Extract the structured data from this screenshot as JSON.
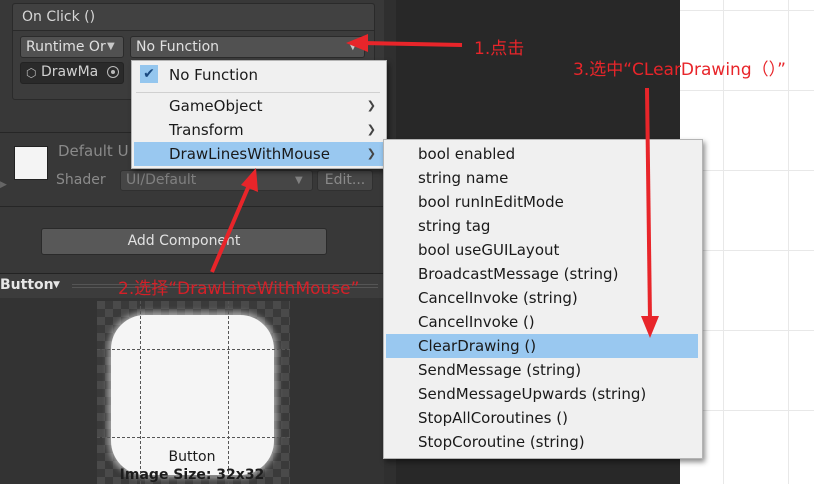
{
  "onclick": {
    "title": "On Click ()",
    "runtime_dropdown": "Runtime Or",
    "function_dropdown": "No Function",
    "object_field": "DrawMa"
  },
  "material": {
    "name": "Default U",
    "shader_label": "Shader",
    "shader_value": "UI/Default",
    "edit_button": "Edit..."
  },
  "add_component_label": "Add Component",
  "preview": {
    "title": "Button",
    "sprite_name": "Button",
    "image_size": "Image Size: 32x32"
  },
  "function_menu": {
    "items": [
      {
        "label": "No Function",
        "checked": true
      },
      {
        "label": "GameObject",
        "submenu": true
      },
      {
        "label": "Transform",
        "submenu": true
      },
      {
        "label": "DrawLinesWithMouse",
        "submenu": true,
        "highlighted": true
      }
    ]
  },
  "member_menu": {
    "items": [
      {
        "label": "bool enabled"
      },
      {
        "label": "string name"
      },
      {
        "label": "bool runInEditMode"
      },
      {
        "label": "string tag"
      },
      {
        "label": "bool useGUILayout"
      },
      {
        "label": "BroadcastMessage (string)"
      },
      {
        "label": "CancelInvoke (string)"
      },
      {
        "label": "CancelInvoke ()"
      },
      {
        "label": "ClearDrawing ()",
        "highlighted": true
      },
      {
        "label": "SendMessage (string)"
      },
      {
        "label": "SendMessageUpwards (string)"
      },
      {
        "label": "StopAllCoroutines ()"
      },
      {
        "label": "StopCoroutine (string)"
      }
    ]
  },
  "annotations": {
    "step1": "1.点击",
    "step2": "2.选择“DrawLineWithMouse”",
    "step3": "3.选中“CLearDrawing（）”"
  },
  "colors": {
    "menu_highlight": "#99c8f0",
    "annotation_red": "#e8252a"
  }
}
